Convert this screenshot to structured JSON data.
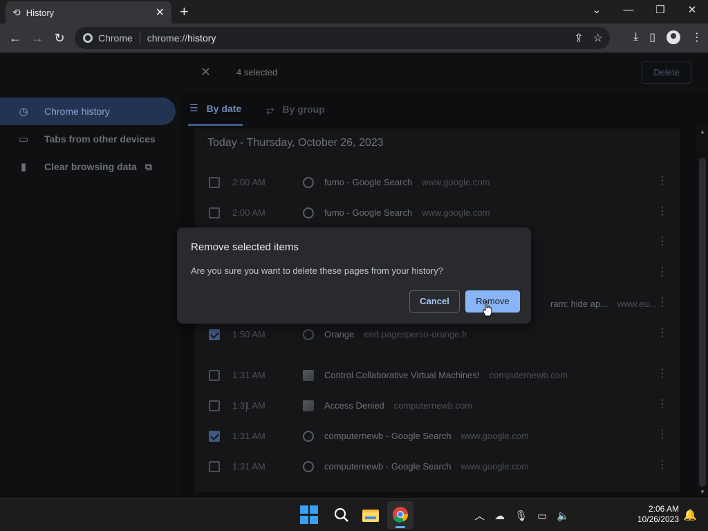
{
  "browser": {
    "tab_title": "History",
    "tab_close": "✕",
    "new_tab": "+",
    "window_buttons": [
      "⌄",
      "—",
      "❐",
      "✕"
    ],
    "omnibox_site": "Chrome",
    "omnibox_url_prefix": "chrome://",
    "omnibox_url_path": "history"
  },
  "selection_bar": {
    "close": "✕",
    "count_text": "4 selected",
    "delete_label": "Delete"
  },
  "sidebar": {
    "items": [
      {
        "label": "Chrome history",
        "icon": "clock-icon",
        "active": true
      },
      {
        "label": "Tabs from other devices",
        "icon": "devices-icon",
        "active": false
      },
      {
        "label": "Clear browsing data",
        "icon": "trash-icon",
        "active": false
      }
    ]
  },
  "history_tabs": [
    {
      "label": "By date",
      "active": true
    },
    {
      "label": "By group",
      "active": false
    }
  ],
  "history": {
    "date_heading": "Today - Thursday, October 26, 2023",
    "rows": [
      {
        "time": "2:00 AM",
        "title": "fumo - Google Search",
        "domain": "www.google.com",
        "checked": false,
        "icon": "google-icon"
      },
      {
        "time": "2:00 AM",
        "title": "fumo - Google Search",
        "domain": "www.google.com",
        "checked": false,
        "icon": "google-icon"
      },
      {
        "time": "",
        "title": "",
        "domain": "",
        "checked": false,
        "icon": ""
      },
      {
        "time": "",
        "title": "",
        "domain": "",
        "checked": false,
        "icon": ""
      },
      {
        "time": "",
        "title": "ram: hide ap...",
        "domain": "www.eu...",
        "checked": false,
        "icon": ""
      },
      {
        "time": "1:50 AM",
        "title": "Orange",
        "domain": "end.pagesperso-orange.fr",
        "checked": true,
        "icon": "globe-icon"
      },
      {
        "time": "1:31 AM",
        "title": "Control Collaborative Virtual Machines!",
        "domain": "computernewb.com",
        "checked": false,
        "icon": "site-icon"
      },
      {
        "time": "1:31 AM",
        "title": "Access Denied",
        "domain": "computernewb.com",
        "checked": false,
        "icon": "site-icon"
      },
      {
        "time": "1:31 AM",
        "title": "computernewb - Google Search",
        "domain": "www.google.com",
        "checked": true,
        "icon": "google-icon"
      },
      {
        "time": "1:31 AM",
        "title": "computernewb - Google Search",
        "domain": "www.google.com",
        "checked": false,
        "icon": "google-icon"
      }
    ]
  },
  "dialog": {
    "title": "Remove selected items",
    "message": "Are you sure you want to delete these pages from your history?",
    "cancel_label": "Cancel",
    "remove_label": "Remove"
  },
  "taskbar": {
    "time": "2:06 AM",
    "date": "10/26/2023"
  },
  "colors": {
    "accent": "#8ab4f8",
    "dialog_bg": "#292a2d",
    "windows_blue": "#3aa0f3"
  }
}
